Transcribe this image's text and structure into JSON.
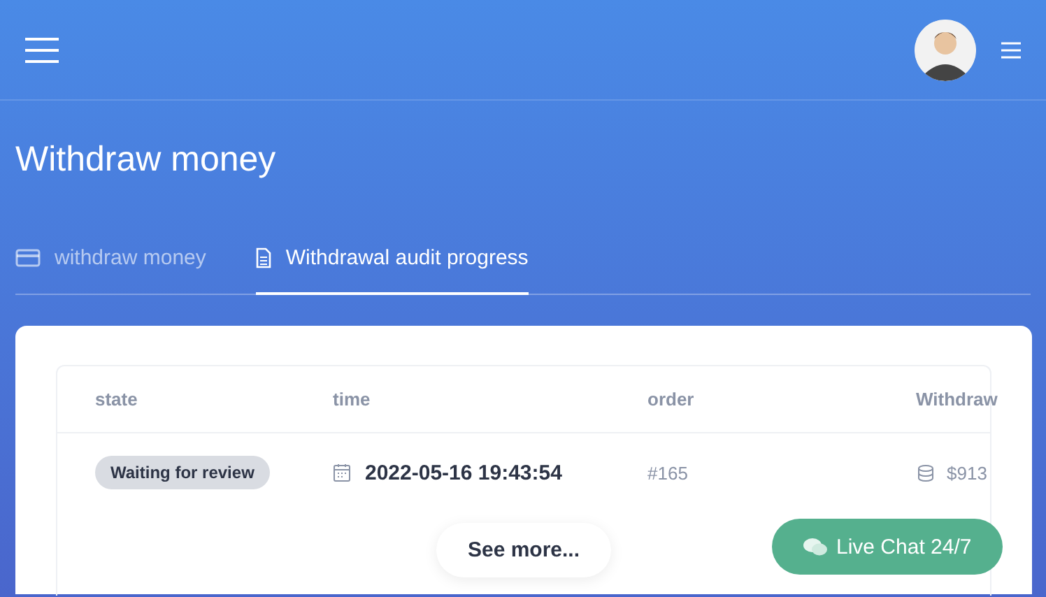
{
  "header": {
    "title": "Withdraw money"
  },
  "tabs": [
    {
      "label": "withdraw money",
      "kind": "card",
      "selected": false
    },
    {
      "label": "Withdrawal audit progress",
      "kind": "document",
      "selected": true
    }
  ],
  "table": {
    "columns": [
      "state",
      "time",
      "order",
      "Withdraw"
    ],
    "rows": [
      {
        "state": "Waiting for review",
        "time": "2022-05-16 19:43:54",
        "order": "#165",
        "amount": "$913"
      }
    ]
  },
  "see_more": "See more...",
  "live_chat": "Live Chat 24/7"
}
